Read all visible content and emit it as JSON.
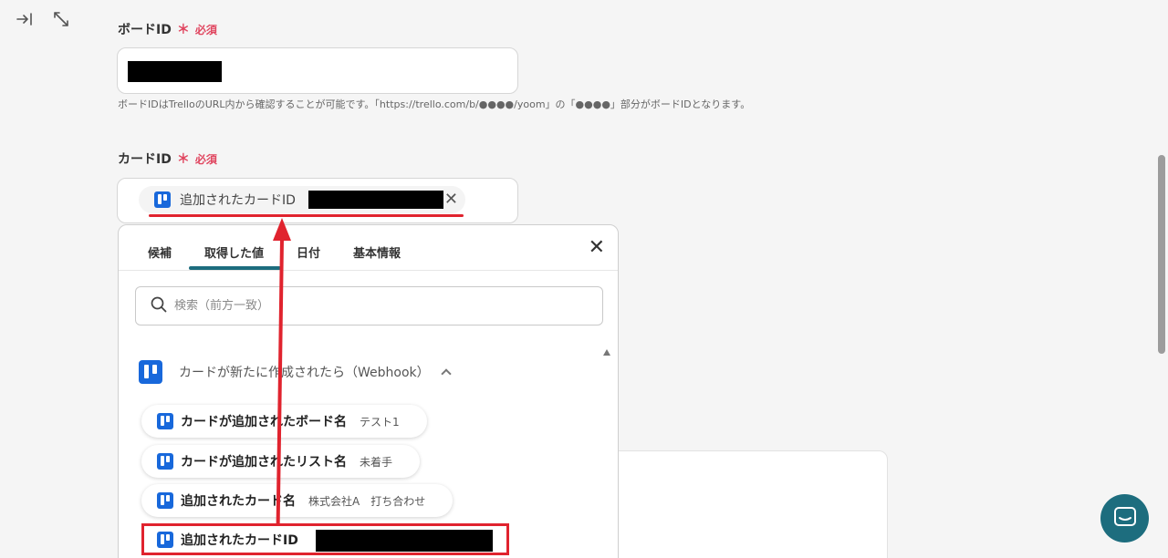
{
  "toolbar": {
    "collapse_icon": "collapse-right-icon",
    "expand_icon": "expand-diagonal-icon"
  },
  "board_field": {
    "label": "ボードID",
    "required_star": "＊",
    "required_label": "必須",
    "hint": "ボードIDはTrelloのURL内から確認することが可能です。「https://trello.com/b/●●●●/yoom」の「●●●●」部分がボードIDとなります。"
  },
  "card_field": {
    "label": "カードID",
    "required_star": "＊",
    "required_label": "必須",
    "chip_label": "追加されたカードID"
  },
  "panel": {
    "tabs": [
      {
        "label": "候補"
      },
      {
        "label": "取得した値",
        "active": true
      },
      {
        "label": "日付"
      },
      {
        "label": "基本情報"
      }
    ],
    "search_placeholder": "検索（前方一致）",
    "section_title": "カードが新たに作成されたら（Webhook）",
    "items": [
      {
        "name": "カードが追加されたボード名",
        "value": "テスト1"
      },
      {
        "name": "カードが追加されたリスト名",
        "value": "未着手"
      },
      {
        "name": "追加されたカード名",
        "value": "株式会社A　打ち合わせ"
      },
      {
        "name": "追加されたカードID",
        "value": ""
      }
    ]
  },
  "colors": {
    "accent": "#1d6d7e",
    "required": "#e0455f",
    "highlight": "#e0232e",
    "trello": "#1868db"
  }
}
